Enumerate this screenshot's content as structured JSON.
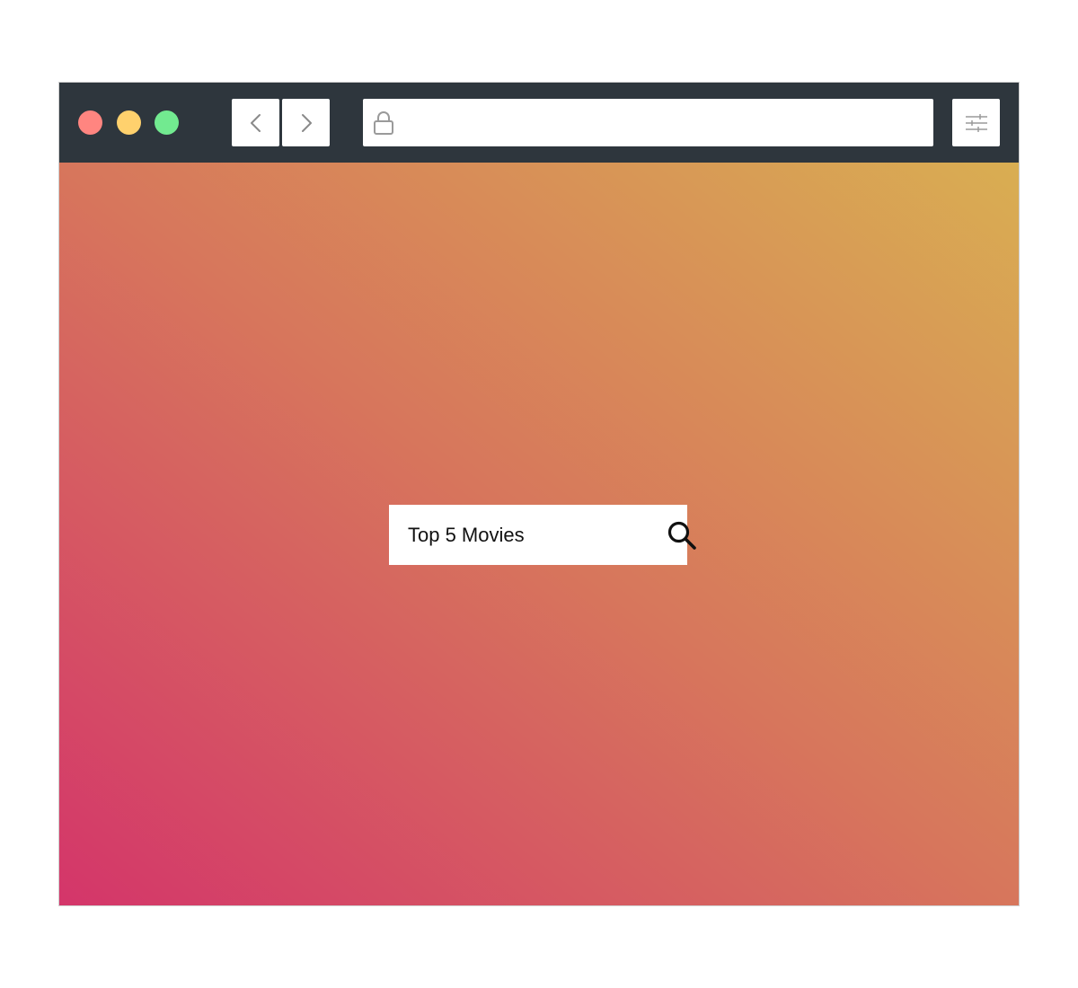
{
  "colors": {
    "titlebar": "#2e363d",
    "close_dot": "#ff8580",
    "minimize_dot": "#ffd16d",
    "maximize_dot": "#72ea90",
    "gradient_start": "#d4356a",
    "gradient_mid": "#d7765c",
    "gradient_end": "#d9ae52"
  },
  "toolbar": {
    "back_icon": "chevron-left-icon",
    "forward_icon": "chevron-right-icon",
    "address_icon": "lock-icon",
    "address_value": "",
    "settings_icon": "sliders-icon"
  },
  "search": {
    "value": "Top 5 Movies",
    "icon": "search-icon"
  }
}
